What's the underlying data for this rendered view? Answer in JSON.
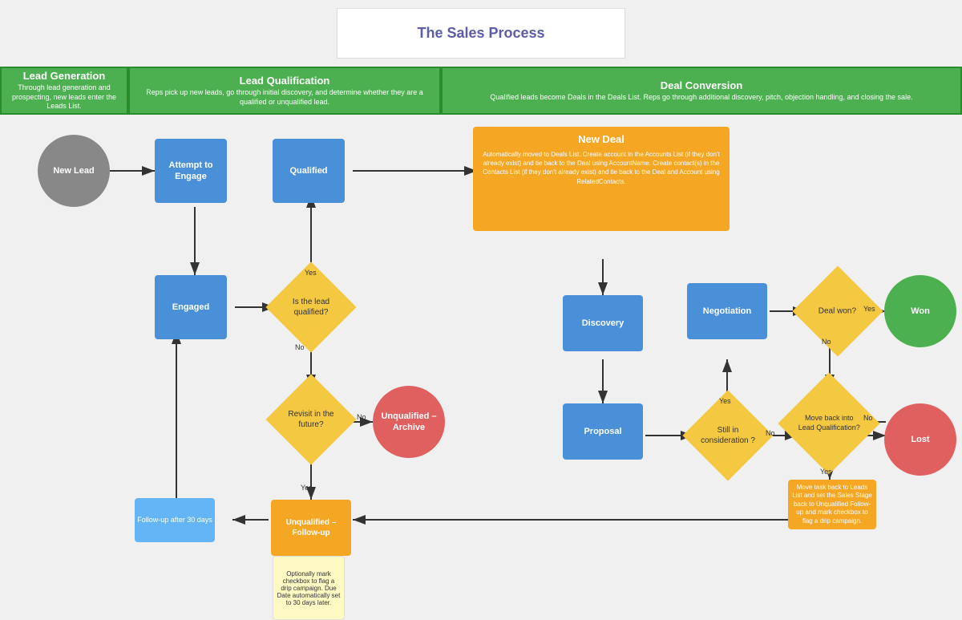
{
  "title": "The Sales Process",
  "phases": [
    {
      "id": "lead-gen",
      "label": "Lead Generation",
      "desc": "Through lead generation and prospecting, new leads enter the Leads List."
    },
    {
      "id": "lead-qual",
      "label": "Lead Qualification",
      "desc": "Reps pick up new leads, go through initial discovery, and determine whether they are a qualified or unqualified lead."
    },
    {
      "id": "deal-conv",
      "label": "Deal Conversion",
      "desc": "Qualified leads become Deals in the Deals List. Reps go through additional discovery, pitch, objection handling, and closing the sale."
    }
  ],
  "nodes": {
    "new_lead": "New Lead",
    "attempt_to_engage": "Attempt to\nEngage",
    "qualified": "Qualified",
    "engaged": "Engaged",
    "is_lead_qualified": "Is the lead\nqualified?",
    "revisit_future": "Revisit in the\nfuture?",
    "unqualified_archive": "Unqualified –\nArchive",
    "unqualified_followup": "Unqualified –\nFollow-up",
    "followup_30days": "Follow-up after 30 days",
    "followup_desc": "Optionally mark checkbox to flag a drip campaign. Due Date automatically set to 30 days later.",
    "new_deal": "New Deal",
    "new_deal_desc": "Automatically moved to Deals List. Create account in the Accounts List (if they don't already exist) and tie back to the Deal using AccountName. Create contact(s) in the Contacts List (if they don't already exist) and tie back to the Deal and Account using RelatedContacts.",
    "discovery": "Discovery",
    "proposal": "Proposal",
    "negotiation": "Negotiation",
    "still_in_consideration": "Still in\nconsideration\n?",
    "deal_won": "Deal won?",
    "won": "Won",
    "move_back_lead": "Move back\ninto Lead\nQualification?",
    "lost": "Lost",
    "move_back_desc": "Move task back to Leads List and set the Sales Stage back to Unqualified Follow-up and mark checkbox to flag a drip campaign.",
    "yes": "Yes",
    "no": "No"
  }
}
